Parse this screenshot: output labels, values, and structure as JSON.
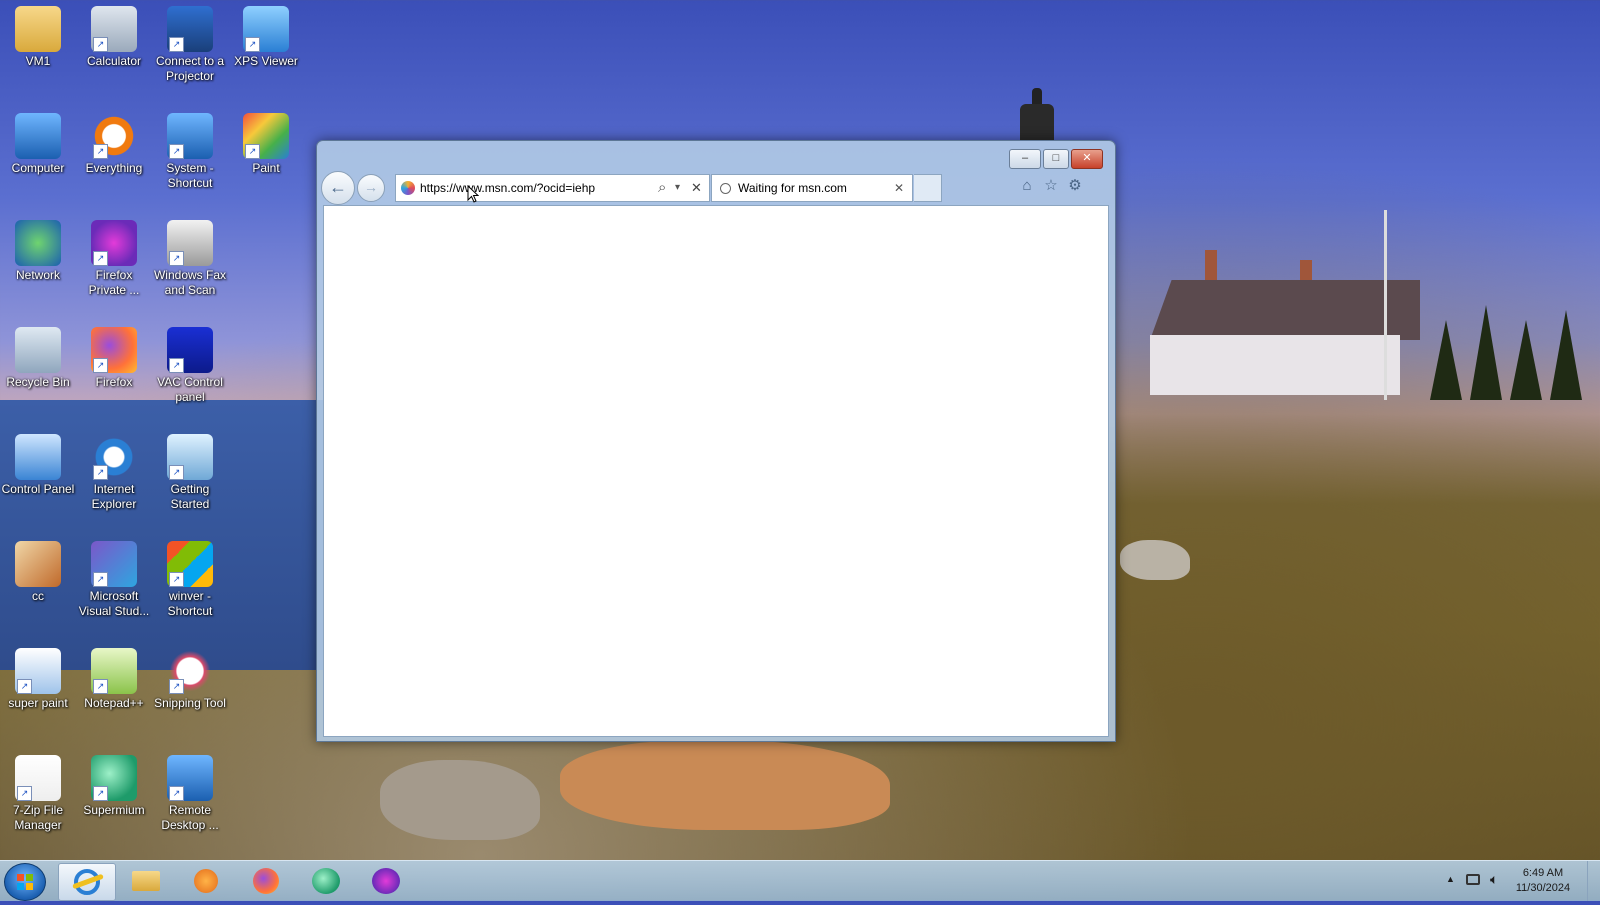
{
  "desktop": {
    "icons": [
      {
        "label": "VM1",
        "icon": "folder-user-icon",
        "shortcut": false
      },
      {
        "label": "Calculator",
        "icon": "calculator-icon",
        "shortcut": true
      },
      {
        "label": "Connect to a Projector",
        "icon": "projector-icon",
        "shortcut": true
      },
      {
        "label": "XPS Viewer",
        "icon": "xps-viewer-icon",
        "shortcut": true
      },
      {
        "label": "Computer",
        "icon": "computer-icon",
        "shortcut": false
      },
      {
        "label": "Everything",
        "icon": "everything-search-icon",
        "shortcut": true
      },
      {
        "label": "System - Shortcut",
        "icon": "system-icon",
        "shortcut": true
      },
      {
        "label": "Paint",
        "icon": "paint-icon",
        "shortcut": true
      },
      {
        "label": "Network",
        "icon": "network-icon",
        "shortcut": false
      },
      {
        "label": "Firefox Private ...",
        "icon": "firefox-private-icon",
        "shortcut": true
      },
      {
        "label": "Windows Fax and Scan",
        "icon": "fax-scan-icon",
        "shortcut": true
      },
      {
        "label": "Recycle Bin",
        "icon": "recycle-bin-icon",
        "shortcut": false
      },
      {
        "label": "Firefox",
        "icon": "firefox-icon",
        "shortcut": true
      },
      {
        "label": "VAC Control panel",
        "icon": "vac-control-icon",
        "shortcut": true
      },
      {
        "label": "Control Panel",
        "icon": "control-panel-icon",
        "shortcut": false
      },
      {
        "label": "Internet Explorer",
        "icon": "internet-explorer-icon",
        "shortcut": true
      },
      {
        "label": "Getting Started",
        "icon": "getting-started-icon",
        "shortcut": true
      },
      {
        "label": "cc",
        "icon": "image-file-icon",
        "shortcut": false
      },
      {
        "label": "Microsoft Visual Stud...",
        "icon": "visual-studio-icon",
        "shortcut": true
      },
      {
        "label": "winver - Shortcut",
        "icon": "windows-logo-icon",
        "shortcut": true
      },
      {
        "label": "super paint",
        "icon": "super-paint-icon",
        "shortcut": true
      },
      {
        "label": "Notepad++",
        "icon": "notepad-plus-plus-icon",
        "shortcut": true
      },
      {
        "label": "Snipping Tool",
        "icon": "snipping-tool-icon",
        "shortcut": true
      },
      {
        "label": "7-Zip File Manager",
        "icon": "7zip-icon",
        "shortcut": true
      },
      {
        "label": "Supermium",
        "icon": "supermium-icon",
        "shortcut": true
      },
      {
        "label": "Remote Desktop ...",
        "icon": "remote-desktop-icon",
        "shortcut": true
      }
    ]
  },
  "browser": {
    "url": "https://www.msn.com/?ocid=iehp",
    "tab_title": "Waiting for msn.com",
    "minimize": "–",
    "maximize": "□",
    "close": "✕",
    "back": "←",
    "forward": "→",
    "search_glyph": "⌕",
    "dropdown_glyph": "▾",
    "stop_glyph": "✕",
    "tab_close_glyph": "✕",
    "home_glyph": "⌂",
    "favorites_glyph": "☆",
    "tools_glyph": "⚙"
  },
  "taskbar": {
    "items": [
      "internet-explorer-icon",
      "file-explorer-icon",
      "media-player-icon",
      "firefox-icon",
      "supermium-icon",
      "firefox-private-icon"
    ],
    "tray": {
      "time": "6:49 AM",
      "date": "11/30/2024",
      "show_hidden": "▲"
    }
  }
}
